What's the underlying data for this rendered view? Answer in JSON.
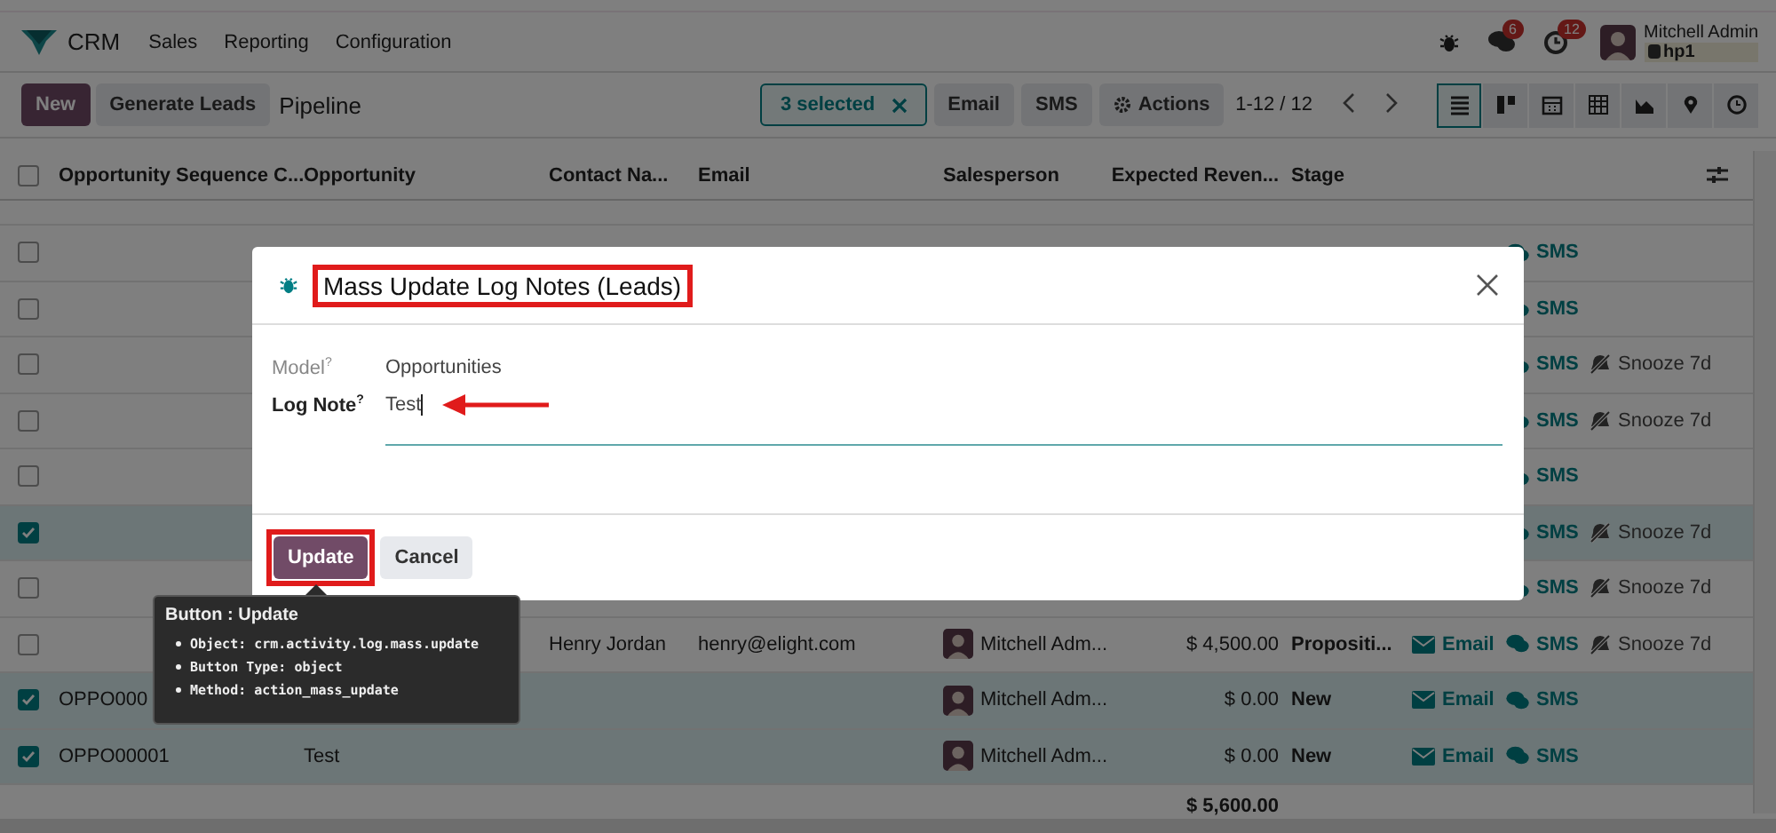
{
  "navbar": {
    "app_name": "CRM",
    "menu": [
      "Sales",
      "Reporting",
      "Configuration"
    ],
    "notifications": [
      {
        "kind": "chat",
        "count": "6"
      },
      {
        "kind": "activity",
        "count": "12"
      }
    ],
    "user": {
      "name": "Mitchell Admin",
      "database": "hp1"
    }
  },
  "control_panel": {
    "buttons": [
      {
        "label": "New",
        "kind": "primary"
      },
      {
        "label": "Generate Leads",
        "kind": "secondary"
      }
    ],
    "breadcrumb": "Pipeline",
    "selection": "3 selected",
    "actions": [
      {
        "label": "Email",
        "kind": "plain"
      },
      {
        "label": "SMS",
        "kind": "plain"
      },
      {
        "label": "Actions",
        "kind": "gear"
      }
    ],
    "pager": "1-12 / 12",
    "views": [
      {
        "kind": "list",
        "selected": true
      },
      {
        "kind": "kanban",
        "selected": false
      },
      {
        "kind": "calendar",
        "selected": false
      },
      {
        "kind": "pivot",
        "selected": false
      },
      {
        "kind": "graph",
        "selected": false
      },
      {
        "kind": "map",
        "selected": false
      },
      {
        "kind": "activity",
        "selected": false
      }
    ]
  },
  "table": {
    "all_selected": false,
    "columns": [
      "Opportunity Sequence C...",
      "Opportunity",
      "Contact Na...",
      "Email",
      "Salesperson",
      "Expected Reven...",
      "Stage"
    ],
    "rows": [
      {
        "checked": false,
        "actions": [
          {
            "kind": "sms",
            "label": "SMS"
          }
        ]
      },
      {
        "checked": false,
        "actions": [
          {
            "kind": "sms",
            "label": "SMS"
          }
        ]
      },
      {
        "checked": false,
        "actions": [
          {
            "kind": "sms",
            "label": "SMS"
          },
          {
            "kind": "snooze",
            "label": "Snooze 7d"
          }
        ]
      },
      {
        "checked": false,
        "actions": [
          {
            "kind": "sms",
            "label": "SMS"
          },
          {
            "kind": "snooze",
            "label": "Snooze 7d"
          }
        ]
      },
      {
        "checked": false,
        "actions": [
          {
            "kind": "sms",
            "label": "SMS"
          }
        ]
      },
      {
        "checked": true,
        "actions": [
          {
            "kind": "sms",
            "label": "SMS"
          },
          {
            "kind": "snooze",
            "label": "Snooze 7d"
          }
        ]
      },
      {
        "checked": false,
        "actions": [
          {
            "kind": "sms",
            "label": "SMS"
          },
          {
            "kind": "snooze",
            "label": "Snooze 7d"
          }
        ]
      },
      {
        "checked": false,
        "contact": "Henry Jordan",
        "email": "henry@elight.com",
        "salesperson": "Mitchell Adm...",
        "revenue": "$ 4,500.00",
        "stage": "Propositi...",
        "actions": [
          {
            "kind": "email",
            "label": "Email"
          },
          {
            "kind": "sms",
            "label": "SMS"
          },
          {
            "kind": "snooze",
            "label": "Snooze 7d"
          }
        ]
      },
      {
        "checked": true,
        "sequence": "OPPO000",
        "salesperson": "Mitchell Adm...",
        "revenue": "$ 0.00",
        "stage": "New",
        "actions": [
          {
            "kind": "email",
            "label": "Email"
          },
          {
            "kind": "sms",
            "label": "SMS"
          }
        ]
      },
      {
        "checked": true,
        "sequence": "OPPO00001",
        "opportunity": "Test",
        "salesperson": "Mitchell Adm...",
        "revenue": "$ 0.00",
        "stage": "New",
        "actions": [
          {
            "kind": "email",
            "label": "Email"
          },
          {
            "kind": "sms",
            "label": "SMS"
          }
        ]
      }
    ],
    "total": "$ 5,600.00"
  },
  "dialog": {
    "title": "Mass Update Log Notes (Leads)",
    "fields": [
      {
        "label": "Model$^{?}$",
        "value": "Opportunities",
        "kind": "readonly"
      },
      {
        "label": "Log Note$^{?}$",
        "value": "Test",
        "kind": "input"
      }
    ],
    "buttons": [
      {
        "label": "Update",
        "kind": "primary"
      },
      {
        "label": "Cancel",
        "kind": "secondary"
      }
    ],
    "tooltip": {
      "title": "Button : Update",
      "items": [
        "Object: crm.activity.log.mass.update",
        "Button Type: object",
        "Method: action_mass_update"
      ]
    }
  }
}
